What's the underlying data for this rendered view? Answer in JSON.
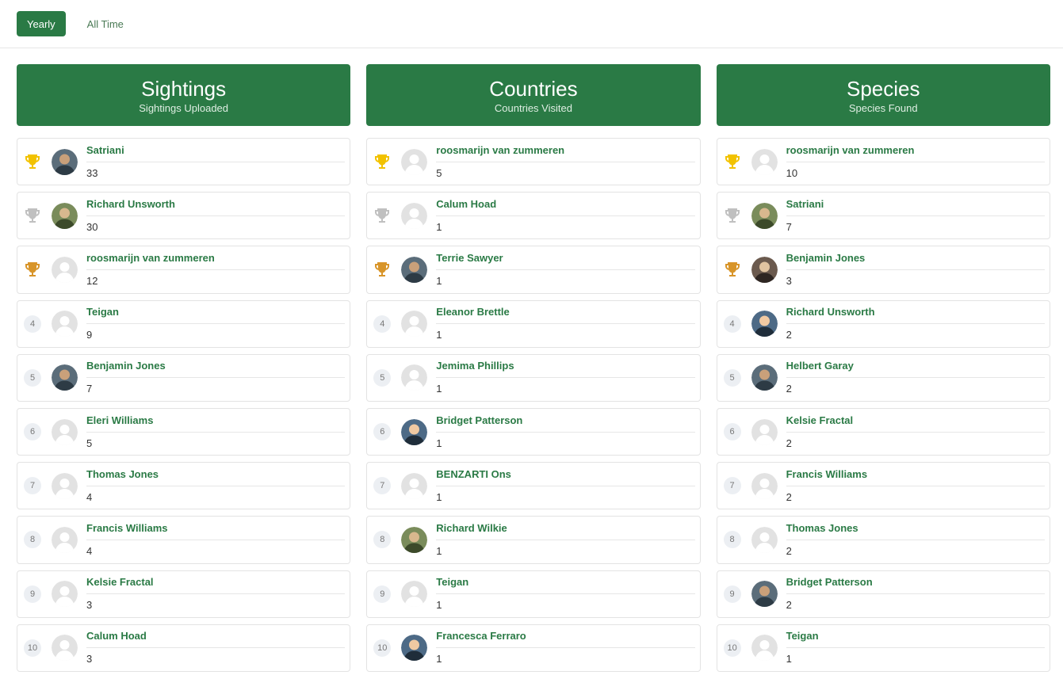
{
  "tabs": [
    {
      "label": "Yearly",
      "active": true
    },
    {
      "label": "All Time",
      "active": false
    }
  ],
  "colors": {
    "brand": "#2a7a45",
    "gold": "#f2c200",
    "silver": "#c0c0c0",
    "bronze": "#d8952a"
  },
  "columns": [
    {
      "title": "Sightings",
      "subtitle": "Sightings Uploaded",
      "rows": [
        {
          "rank": "1",
          "trophy": "gold",
          "name": "Satriani",
          "value": "33",
          "avatar": "photo"
        },
        {
          "rank": "2",
          "trophy": "silver",
          "name": "Richard Unsworth",
          "value": "30",
          "avatar": "photo"
        },
        {
          "rank": "3",
          "trophy": "bronze",
          "name": "roosmarijn van zummeren",
          "value": "12",
          "avatar": "default"
        },
        {
          "rank": "4",
          "trophy": "",
          "name": "Teigan",
          "value": "9",
          "avatar": "default"
        },
        {
          "rank": "5",
          "trophy": "",
          "name": "Benjamin Jones",
          "value": "7",
          "avatar": "photo"
        },
        {
          "rank": "6",
          "trophy": "",
          "name": "Eleri Williams",
          "value": "5",
          "avatar": "default"
        },
        {
          "rank": "7",
          "trophy": "",
          "name": "Thomas Jones",
          "value": "4",
          "avatar": "default"
        },
        {
          "rank": "8",
          "trophy": "",
          "name": "Francis Williams",
          "value": "4",
          "avatar": "default"
        },
        {
          "rank": "9",
          "trophy": "",
          "name": "Kelsie Fractal",
          "value": "3",
          "avatar": "default"
        },
        {
          "rank": "10",
          "trophy": "",
          "name": "Calum Hoad",
          "value": "3",
          "avatar": "default"
        }
      ]
    },
    {
      "title": "Countries",
      "subtitle": "Countries Visited",
      "rows": [
        {
          "rank": "1",
          "trophy": "gold",
          "name": "roosmarijn van zummeren",
          "value": "5",
          "avatar": "default"
        },
        {
          "rank": "2",
          "trophy": "silver",
          "name": "Calum Hoad",
          "value": "1",
          "avatar": "default"
        },
        {
          "rank": "3",
          "trophy": "bronze",
          "name": "Terrie Sawyer",
          "value": "1",
          "avatar": "photo"
        },
        {
          "rank": "4",
          "trophy": "",
          "name": "Eleanor Brettle",
          "value": "1",
          "avatar": "default"
        },
        {
          "rank": "5",
          "trophy": "",
          "name": "Jemima Phillips",
          "value": "1",
          "avatar": "default"
        },
        {
          "rank": "6",
          "trophy": "",
          "name": "Bridget Patterson",
          "value": "1",
          "avatar": "photo"
        },
        {
          "rank": "7",
          "trophy": "",
          "name": "BENZARTI Ons",
          "value": "1",
          "avatar": "default"
        },
        {
          "rank": "8",
          "trophy": "",
          "name": "Richard Wilkie",
          "value": "1",
          "avatar": "photo"
        },
        {
          "rank": "9",
          "trophy": "",
          "name": "Teigan",
          "value": "1",
          "avatar": "default"
        },
        {
          "rank": "10",
          "trophy": "",
          "name": "Francesca Ferraro",
          "value": "1",
          "avatar": "photo"
        }
      ]
    },
    {
      "title": "Species",
      "subtitle": "Species Found",
      "rows": [
        {
          "rank": "1",
          "trophy": "gold",
          "name": "roosmarijn van zummeren",
          "value": "10",
          "avatar": "default"
        },
        {
          "rank": "2",
          "trophy": "silver",
          "name": "Satriani",
          "value": "7",
          "avatar": "photo"
        },
        {
          "rank": "3",
          "trophy": "bronze",
          "name": "Benjamin Jones",
          "value": "3",
          "avatar": "photo"
        },
        {
          "rank": "4",
          "trophy": "",
          "name": "Richard Unsworth",
          "value": "2",
          "avatar": "photo"
        },
        {
          "rank": "5",
          "trophy": "",
          "name": "Helbert Garay",
          "value": "2",
          "avatar": "photo"
        },
        {
          "rank": "6",
          "trophy": "",
          "name": "Kelsie Fractal",
          "value": "2",
          "avatar": "default"
        },
        {
          "rank": "7",
          "trophy": "",
          "name": "Francis Williams",
          "value": "2",
          "avatar": "default"
        },
        {
          "rank": "8",
          "trophy": "",
          "name": "Thomas Jones",
          "value": "2",
          "avatar": "default"
        },
        {
          "rank": "9",
          "trophy": "",
          "name": "Bridget Patterson",
          "value": "2",
          "avatar": "photo"
        },
        {
          "rank": "10",
          "trophy": "",
          "name": "Teigan",
          "value": "1",
          "avatar": "default"
        }
      ]
    }
  ]
}
